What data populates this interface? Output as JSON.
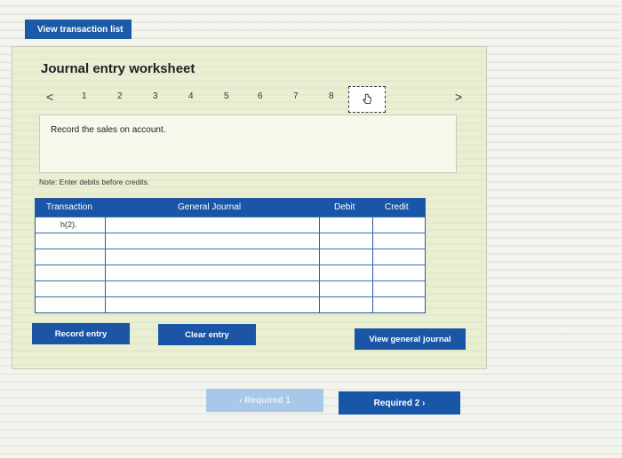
{
  "top": {
    "view_transaction_list": "View transaction list"
  },
  "worksheet": {
    "title": "Journal entry worksheet",
    "pages": [
      "1",
      "2",
      "3",
      "4",
      "5",
      "6",
      "7",
      "8"
    ],
    "prev_arrow": "<",
    "next_arrow": ">",
    "active_page_icon": "hand-pointer-icon",
    "instruction": "Record the sales on account.",
    "note": "Note: Enter debits before credits."
  },
  "journal": {
    "headers": {
      "transaction": "Transaction",
      "general_journal": "General Journal",
      "debit": "Debit",
      "credit": "Credit"
    },
    "rows": [
      {
        "transaction": "h(2).",
        "account": "",
        "debit": "",
        "credit": ""
      },
      {
        "transaction": "",
        "account": "",
        "debit": "",
        "credit": ""
      },
      {
        "transaction": "",
        "account": "",
        "debit": "",
        "credit": ""
      },
      {
        "transaction": "",
        "account": "",
        "debit": "",
        "credit": ""
      },
      {
        "transaction": "",
        "account": "",
        "debit": "",
        "credit": ""
      },
      {
        "transaction": "",
        "account": "",
        "debit": "",
        "credit": ""
      }
    ]
  },
  "buttons": {
    "record_entry": "Record entry",
    "clear_entry": "Clear entry",
    "view_general_journal": "View general journal"
  },
  "nav": {
    "prev_label": "Required 1",
    "next_label": "Required 2"
  },
  "colors": {
    "primary_blue": "#1a55a6",
    "light_blue": "#a8c8ea",
    "panel_bg": "#e9efd2"
  }
}
